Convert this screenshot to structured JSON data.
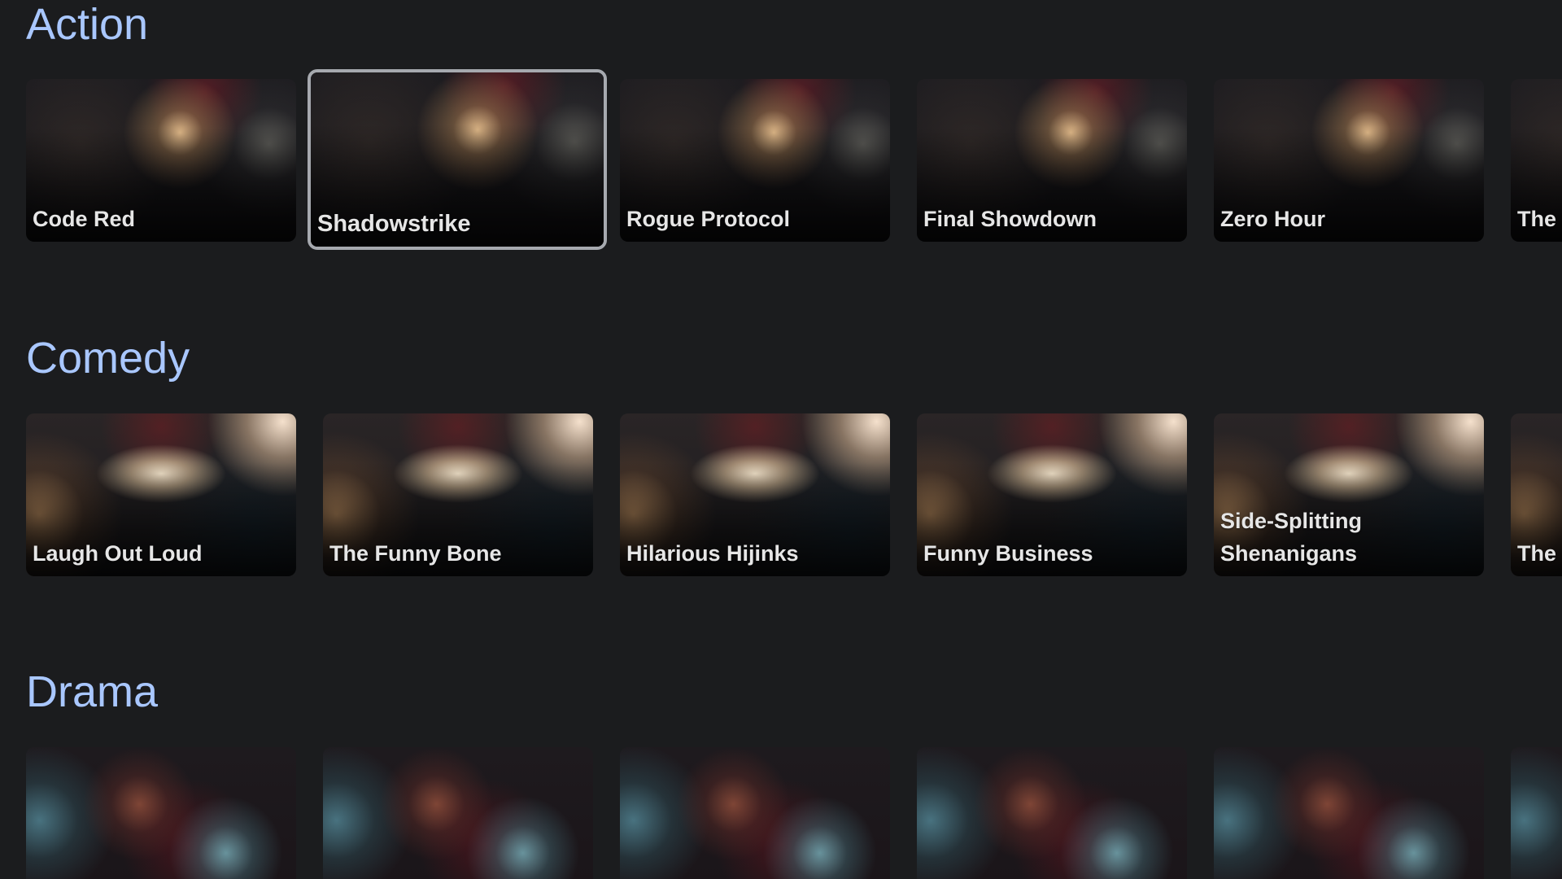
{
  "rows": [
    {
      "title": "Action",
      "items": [
        {
          "title": "Code Red"
        },
        {
          "title": "Shadowstrike",
          "focused": true
        },
        {
          "title": "Rogue Protocol"
        },
        {
          "title": "Final Showdown"
        },
        {
          "title": "Zero Hour"
        },
        {
          "title": "The"
        }
      ]
    },
    {
      "title": "Comedy",
      "items": [
        {
          "title": "Laugh Out Loud"
        },
        {
          "title": "The Funny Bone"
        },
        {
          "title": "Hilarious Hijinks"
        },
        {
          "title": "Funny Business"
        },
        {
          "title": "Side-Splitting Shenanigans"
        },
        {
          "title": "The"
        }
      ]
    },
    {
      "title": "Drama",
      "items": [
        {
          "title": ""
        },
        {
          "title": ""
        },
        {
          "title": ""
        },
        {
          "title": ""
        },
        {
          "title": ""
        },
        {
          "title": ""
        }
      ]
    }
  ],
  "colors": {
    "background": "#1b1c1e",
    "row_title": "#a9c7ff",
    "card_title": "#e6e6e6",
    "focus_border": "#a6a9af"
  }
}
